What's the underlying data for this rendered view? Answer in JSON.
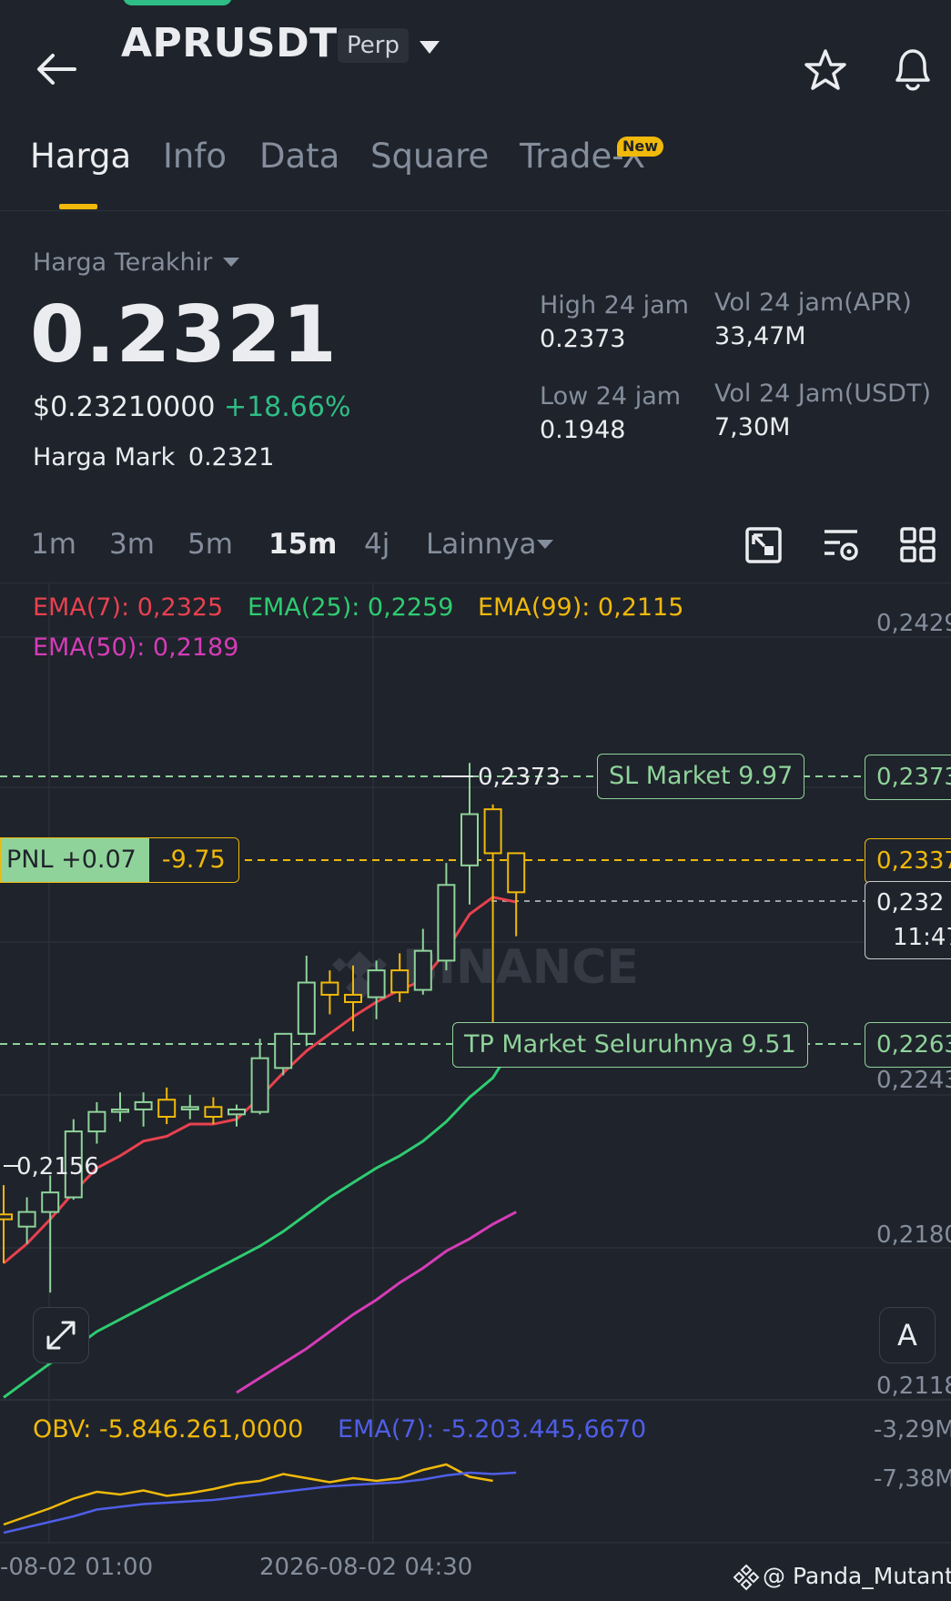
{
  "header": {
    "title": "APRUSDT",
    "badge": "Perp"
  },
  "tabs": [
    {
      "label": "Harga",
      "active": true
    },
    {
      "label": "Info"
    },
    {
      "label": "Data"
    },
    {
      "label": "Square"
    },
    {
      "label": "Trade-X",
      "badge": "New"
    }
  ],
  "price": {
    "selector": "Harga Terakhir",
    "last": "0.2321",
    "usd": "$0.23210000",
    "change": "+18.66%",
    "mark_label": "Harga Mark",
    "mark": "0.2321"
  },
  "stats": {
    "high_label": "High 24 jam",
    "high": "0.2373",
    "low_label": "Low 24 jam",
    "low": "0.1948",
    "vol_apr_label": "Vol 24 jam(APR)",
    "vol_apr": "33,47M",
    "vol_usdt_label": "Vol 24 Jam(USDT)",
    "vol_usdt": "7,30M"
  },
  "timeframes": [
    "1m",
    "3m",
    "5m",
    "15m",
    "4j"
  ],
  "timeframe_active": "15m",
  "timeframe_more": "Lainnya",
  "ema": {
    "ema7": "EMA(7): 0,2325",
    "ema25": "EMA(25): 0,2259",
    "ema99": "EMA(99): 0,2115",
    "ema50": "EMA(50): 0,2189"
  },
  "price_axis": {
    "p1": "0,2429",
    "p2": "0,2373",
    "p3": "0,2337",
    "p4": "0,232",
    "p4_time": "11:47",
    "p5": "0,2263",
    "p6": "0,2243",
    "p7": "0,2180",
    "p8": "0,2118"
  },
  "chart_labels": {
    "high_mark": "0,2373",
    "low_mark": "0,2156",
    "sl": "SL Market 9.97",
    "tp": "TP Market Seluruhnya 9.51",
    "pnl": "PNL +0.07",
    "pnl_value": "-9.75",
    "watermark": "BINANCE",
    "auto": "A"
  },
  "obv": {
    "obv": "OBV: -5.846.261,0000",
    "ema": "EMA(7): -5.203.445,6670",
    "axis1": "-3,29M",
    "axis2": "-7,38M"
  },
  "time_axis": {
    "t1": "-08-02 01:00",
    "t2": "2026-08-02 04:30"
  },
  "credit": "@ Panda_Mutant⁷",
  "colors": {
    "bg": "#1f232b",
    "up": "#8fd39a",
    "down": "#f0b90b",
    "ema7": "#e8414f",
    "ema25": "#2ecc71",
    "ema50": "#d63cb8",
    "ema99": "#f0b90b",
    "obv_ema": "#4f5ee8",
    "positive": "#2ebd85"
  },
  "chart_data": {
    "type": "candlestick",
    "ylim": [
      0.2115,
      0.2432
    ],
    "candles": [
      {
        "o": 0.2188,
        "h": 0.22,
        "l": 0.2168,
        "c": 0.2186
      },
      {
        "o": 0.2183,
        "h": 0.2195,
        "l": 0.2176,
        "c": 0.2189
      },
      {
        "o": 0.2189,
        "h": 0.2204,
        "l": 0.2156,
        "c": 0.2197
      },
      {
        "o": 0.2195,
        "h": 0.2227,
        "l": 0.2194,
        "c": 0.2222
      },
      {
        "o": 0.2222,
        "h": 0.2234,
        "l": 0.2217,
        "c": 0.223
      },
      {
        "o": 0.223,
        "h": 0.2238,
        "l": 0.2226,
        "c": 0.2231
      },
      {
        "o": 0.2231,
        "h": 0.2238,
        "l": 0.2224,
        "c": 0.2234
      },
      {
        "o": 0.2235,
        "h": 0.224,
        "l": 0.2225,
        "c": 0.2228
      },
      {
        "o": 0.2231,
        "h": 0.2237,
        "l": 0.2227,
        "c": 0.2232
      },
      {
        "o": 0.2232,
        "h": 0.2236,
        "l": 0.2225,
        "c": 0.2228
      },
      {
        "o": 0.2229,
        "h": 0.2233,
        "l": 0.2224,
        "c": 0.2231
      },
      {
        "o": 0.223,
        "h": 0.226,
        "l": 0.2229,
        "c": 0.2252
      },
      {
        "o": 0.2248,
        "h": 0.226,
        "l": 0.2245,
        "c": 0.2262
      },
      {
        "o": 0.2262,
        "h": 0.2294,
        "l": 0.2257,
        "c": 0.2283
      },
      {
        "o": 0.2283,
        "h": 0.2288,
        "l": 0.227,
        "c": 0.2278
      },
      {
        "o": 0.2278,
        "h": 0.229,
        "l": 0.2263,
        "c": 0.2275
      },
      {
        "o": 0.2277,
        "h": 0.2292,
        "l": 0.2268,
        "c": 0.2288
      },
      {
        "o": 0.2288,
        "h": 0.2295,
        "l": 0.2275,
        "c": 0.2279
      },
      {
        "o": 0.228,
        "h": 0.2305,
        "l": 0.2278,
        "c": 0.2296
      },
      {
        "o": 0.2292,
        "h": 0.2332,
        "l": 0.2288,
        "c": 0.2323
      },
      {
        "o": 0.2331,
        "h": 0.2373,
        "l": 0.2315,
        "c": 0.2352
      },
      {
        "o": 0.2354,
        "h": 0.2356,
        "l": 0.2265,
        "c": 0.2336
      },
      {
        "o": 0.2336,
        "h": 0.2336,
        "l": 0.2302,
        "c": 0.232
      }
    ],
    "series": [
      {
        "name": "EMA(7)",
        "values": [
          0.2168,
          0.2176,
          0.2186,
          0.2197,
          0.2207,
          0.2212,
          0.2218,
          0.222,
          0.2225,
          0.2225,
          0.2227,
          0.2236,
          0.2246,
          0.2255,
          0.2262,
          0.2269,
          0.2275,
          0.228,
          0.2284,
          0.2296,
          0.2311,
          0.2318,
          0.2316
        ]
      },
      {
        "name": "EMA(25)",
        "values": [
          0.2113,
          0.212,
          0.2127,
          0.2133,
          0.214,
          0.2145,
          0.215,
          0.2155,
          0.216,
          0.2165,
          0.217,
          0.2175,
          0.2181,
          0.2188,
          0.2195,
          0.2201,
          0.2207,
          0.2212,
          0.2218,
          0.2226,
          0.2236,
          0.2244,
          0.2259
        ]
      },
      {
        "name": "EMA(50)",
        "values": [
          null,
          null,
          null,
          null,
          null,
          null,
          null,
          null,
          null,
          null,
          0.2115,
          0.2121,
          0.2127,
          0.2133,
          0.214,
          0.2147,
          0.2153,
          0.216,
          0.2166,
          0.2173,
          0.2178,
          0.2184,
          0.2189
        ]
      },
      {
        "name": "OBV",
        "values": [
          -9.0,
          -8.4,
          -7.8,
          -7.1,
          -6.6,
          -6.8,
          -6.5,
          -6.9,
          -6.7,
          -6.4,
          -6.0,
          -5.8,
          -5.3,
          -5.6,
          -5.9,
          -5.6,
          -5.8,
          -5.6,
          -5.0,
          -4.6,
          -5.5,
          -5.8
        ]
      },
      {
        "name": "EMA(7)",
        "values": [
          -9.6,
          -9.2,
          -8.8,
          -8.4,
          -7.9,
          -7.7,
          -7.5,
          -7.4,
          -7.3,
          -7.2,
          -7.0,
          -6.8,
          -6.6,
          -6.4,
          -6.2,
          -6.1,
          -6.0,
          -5.9,
          -5.7,
          -5.4,
          -5.2,
          -5.3,
          -5.2
        ]
      }
    ]
  }
}
